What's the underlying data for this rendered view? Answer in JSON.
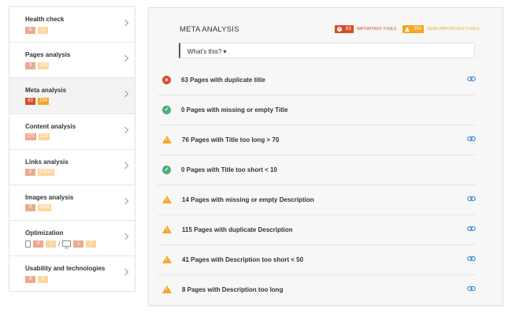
{
  "sidebar": {
    "items": [
      {
        "label": "Health check",
        "badges": [
          {
            "v": "0",
            "c": "red-light"
          },
          {
            "v": "11",
            "c": "orange-light"
          }
        ],
        "active": false
      },
      {
        "label": "Pages analysis",
        "badges": [
          {
            "v": "3",
            "c": "red-light"
          },
          {
            "v": "132",
            "c": "orange-light"
          }
        ],
        "active": false
      },
      {
        "label": "Meta analysis",
        "badges": [
          {
            "v": "63",
            "c": "red"
          },
          {
            "v": "254",
            "c": "orange"
          }
        ],
        "active": true
      },
      {
        "label": "Content analysis",
        "badges": [
          {
            "v": "171",
            "c": "red-light"
          },
          {
            "v": "215",
            "c": "orange-light"
          }
        ],
        "active": false
      },
      {
        "label": "Links analysis",
        "badges": [
          {
            "v": "0",
            "c": "red-light"
          },
          {
            "v": "21610",
            "c": "orange-light"
          }
        ],
        "active": false
      },
      {
        "label": "Images analysis",
        "badges": [
          {
            "v": "0",
            "c": "red-light"
          },
          {
            "v": "6641",
            "c": "orange-light"
          }
        ],
        "active": false
      },
      {
        "label": "Optimization",
        "mobile": [
          "4",
          "1"
        ],
        "desktop": [
          "1",
          "0"
        ],
        "separator": "/",
        "active": false
      },
      {
        "label": "Usability and technologies",
        "badges": [
          {
            "v": "0",
            "c": "red-light"
          },
          {
            "v": "1",
            "c": "orange-light"
          }
        ],
        "active": false
      }
    ]
  },
  "panel": {
    "title": "META ANALYSIS",
    "important": {
      "count": "63",
      "label": "IMPORTANT FIXES"
    },
    "semi_important": {
      "count": "254",
      "label": "SEMI-IMPORTANT FIXES"
    },
    "whats_this": "What's this? ▾"
  },
  "rows": [
    {
      "status": "error",
      "text": "63 Pages with duplicate title",
      "link": true
    },
    {
      "status": "ok",
      "text": "0 Pages with missing or empty Title",
      "link": false
    },
    {
      "status": "warning",
      "text": "76 Pages with Title too long > 70",
      "link": true
    },
    {
      "status": "ok",
      "text": "0 Pages with Title too short < 10",
      "link": false
    },
    {
      "status": "warning",
      "text": "14 Pages with missing or empty Description",
      "link": true
    },
    {
      "status": "warning",
      "text": "115 Pages with duplicate Description",
      "link": true
    },
    {
      "status": "warning",
      "text": "41 Pages with Description too short < 50",
      "link": true
    },
    {
      "status": "warning",
      "text": "8 Pages with Description too long",
      "link": true
    }
  ],
  "colors": {
    "error": "#d94c2a",
    "ok": "#4caf78",
    "warning": "#f5a623",
    "link": "#2f7fd0"
  }
}
